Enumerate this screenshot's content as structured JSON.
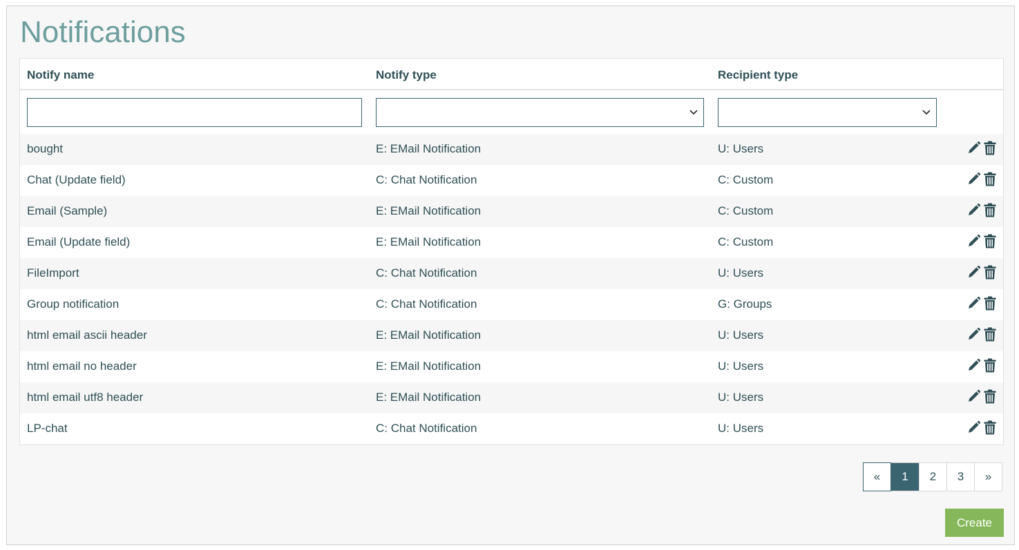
{
  "page": {
    "title": "Notifications"
  },
  "table": {
    "headers": {
      "name": "Notify name",
      "type": "Notify type",
      "recipient": "Recipient type"
    },
    "filters": {
      "name_value": "",
      "type_value": "",
      "recipient_value": ""
    },
    "rows": [
      {
        "name": "bought",
        "type": "E: EMail Notification",
        "recipient": "U: Users"
      },
      {
        "name": "Chat (Update field)",
        "type": "C: Chat Notification",
        "recipient": "C: Custom"
      },
      {
        "name": "Email (Sample)",
        "type": "E: EMail Notification",
        "recipient": "C: Custom"
      },
      {
        "name": "Email (Update field)",
        "type": "E: EMail Notification",
        "recipient": "C: Custom"
      },
      {
        "name": "FileImport",
        "type": "C: Chat Notification",
        "recipient": "U: Users"
      },
      {
        "name": "Group notification",
        "type": "C: Chat Notification",
        "recipient": "G: Groups"
      },
      {
        "name": "html email ascii header",
        "type": "E: EMail Notification",
        "recipient": "U: Users"
      },
      {
        "name": "html email no header",
        "type": "E: EMail Notification",
        "recipient": "U: Users"
      },
      {
        "name": "html email utf8 header",
        "type": "E: EMail Notification",
        "recipient": "U: Users"
      },
      {
        "name": "LP-chat",
        "type": "C: Chat Notification",
        "recipient": "U: Users"
      }
    ],
    "row_icons": {
      "edit": "pencil-icon",
      "delete": "trash-icon"
    }
  },
  "pagination": {
    "prev": "«",
    "pages": [
      "1",
      "2",
      "3"
    ],
    "active": "1",
    "next": "»"
  },
  "actions": {
    "create_label": "Create"
  },
  "colors": {
    "title": "#6e9e9e",
    "text": "#2f4f56",
    "accent": "#3a6470",
    "create": "#86b85b"
  }
}
